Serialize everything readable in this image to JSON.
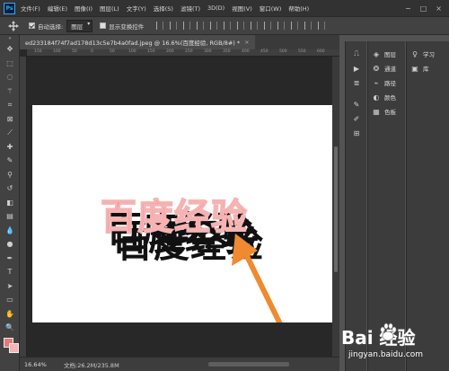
{
  "app": {
    "logo": "Ps"
  },
  "menubar": {
    "items": [
      "文件(F)",
      "编辑(E)",
      "图像(I)",
      "图层(L)",
      "文字(Y)",
      "选择(S)",
      "滤镜(T)",
      "3D(D)",
      "视图(V)",
      "窗口(W)",
      "帮助(H)"
    ],
    "window_controls": [
      "−",
      "□",
      "×"
    ]
  },
  "options": {
    "auto_select_label": "自动选择:",
    "auto_select_value": "图层",
    "show_transform_label": "显示变换控件"
  },
  "document": {
    "tab_title": "ed233184f74f7ad178d13c5e7b4a0fad.jpeg @ 16.6%(百度经验, RGB/8#) *",
    "close": "×",
    "text": "百度经验"
  },
  "ruler": {
    "ticks": [
      "150",
      "100",
      "50",
      "0",
      "50",
      "100",
      "150",
      "200",
      "250",
      "300",
      "350",
      "400",
      "450",
      "500",
      "550",
      "600"
    ]
  },
  "statusbar": {
    "zoom": "16.64%",
    "doc_info": "文档:26.2M/235.8M"
  },
  "panels": [
    {
      "label": "图层",
      "icon": "layers-icon"
    },
    {
      "label": "通道",
      "icon": "channels-icon"
    },
    {
      "label": "路径",
      "icon": "paths-icon"
    },
    {
      "label": "颜色",
      "icon": "color-icon"
    },
    {
      "label": "色板",
      "icon": "swatches-icon"
    }
  ],
  "right_panels": [
    {
      "label": "学习",
      "icon": "learn-icon"
    },
    {
      "label": "库",
      "icon": "libraries-icon"
    }
  ],
  "colors": {
    "foreground": "#e87777",
    "background": "#f4b4b4",
    "text_fill": "#ed7474",
    "arrow": "#f08a30"
  },
  "watermark": {
    "brand": "Bai 经验",
    "url": "jingyan.baidu.com"
  }
}
